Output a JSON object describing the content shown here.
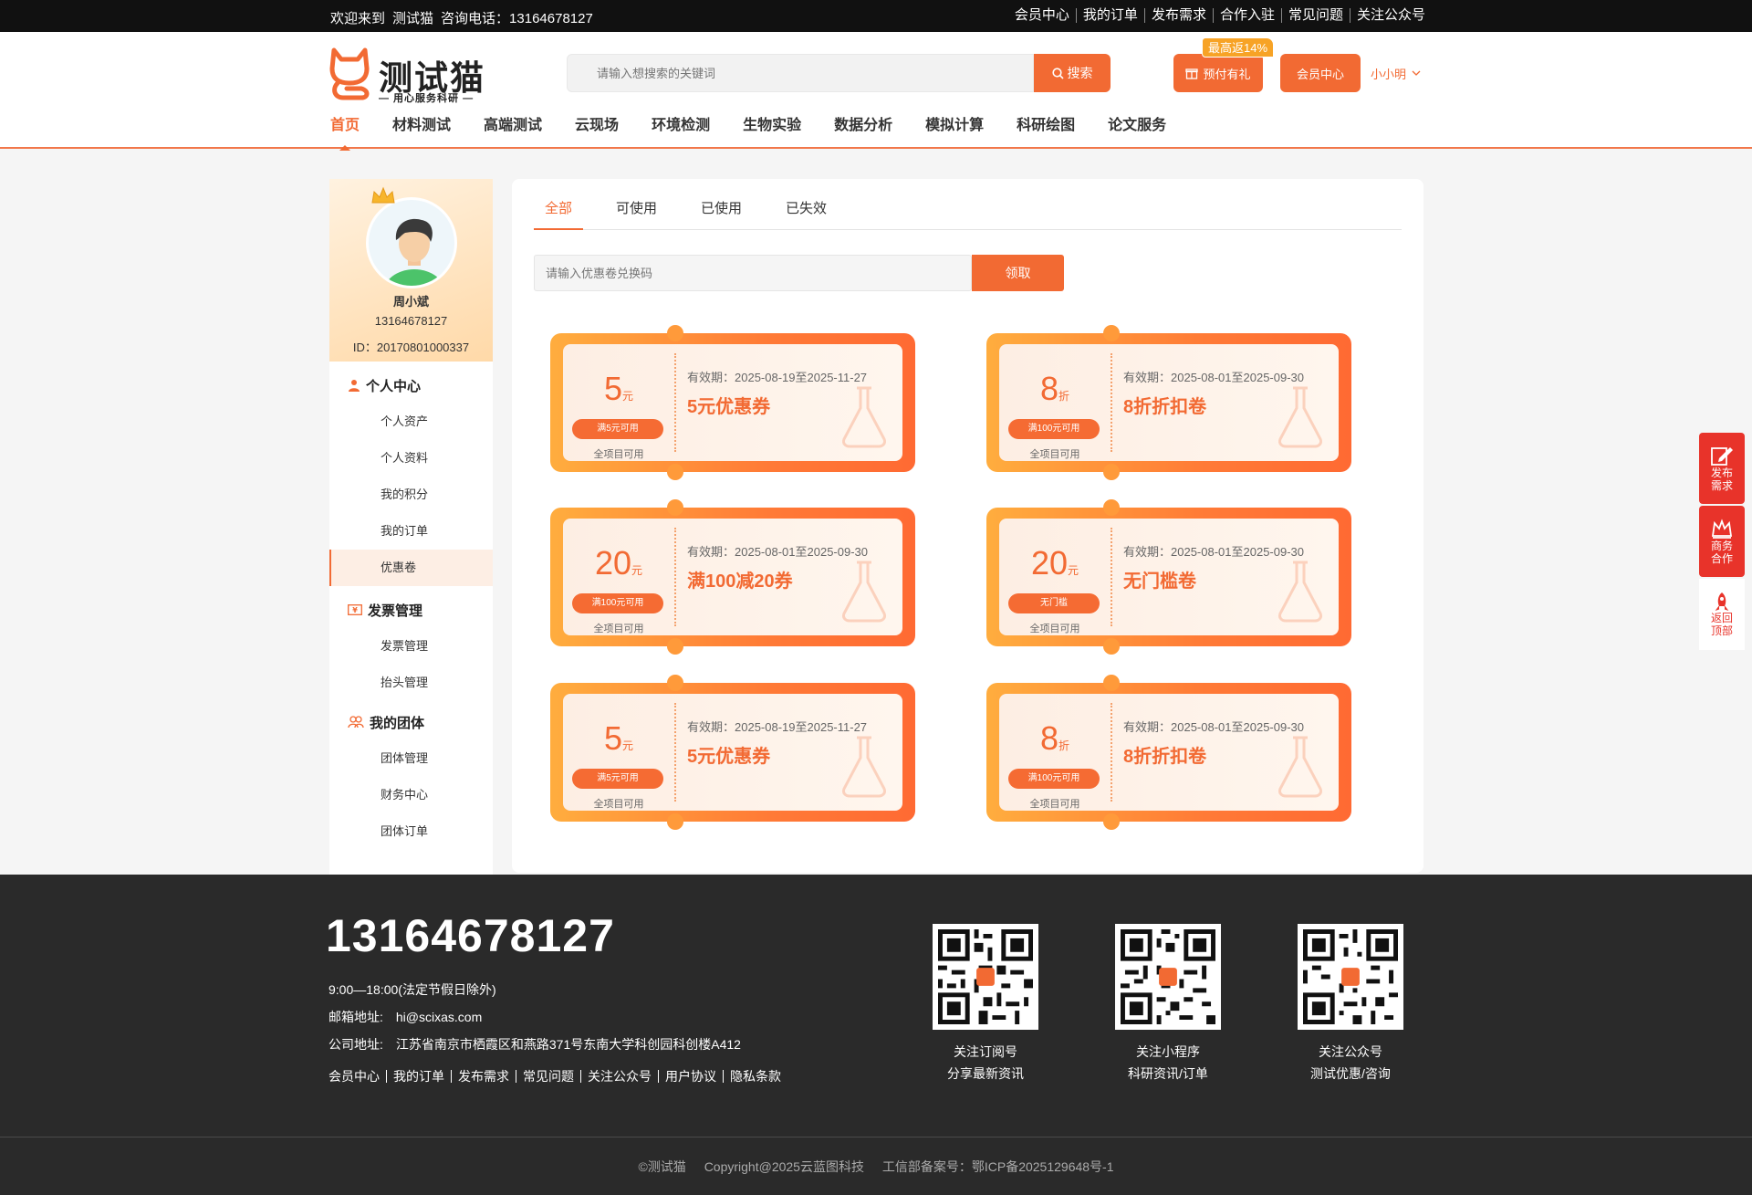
{
  "topbar": {
    "welcome": "欢迎来到",
    "site": "测试猫",
    "hotline_label": "咨询电话：",
    "hotline": "13164678127",
    "links": [
      "会员中心",
      "我的订单",
      "发布需求",
      "合作入驻",
      "常见问题",
      "关注公众号"
    ]
  },
  "header": {
    "brand": "测试猫",
    "slogan": "— 用心服务科研 —",
    "search_placeholder": "请输入想搜索的关键词",
    "search_label": "搜索",
    "promo_badge": "最高返14%",
    "prepay_label": "预付有礼",
    "member_label": "会员中心",
    "username": "小小明"
  },
  "nav": [
    "首页",
    "材料测试",
    "高端测试",
    "云现场",
    "环境检测",
    "生物实验",
    "数据分析",
    "模拟计算",
    "科研绘图",
    "论文服务"
  ],
  "profile": {
    "name": "周小斌",
    "phone": "13164678127",
    "id": "ID：20170801000337"
  },
  "menu": {
    "personal": {
      "title": "个人中心",
      "items": [
        "个人资产",
        "个人资料",
        "我的积分",
        "我的订单",
        "优惠卷"
      ]
    },
    "invoice": {
      "title": "发票管理",
      "items": [
        "发票管理",
        "抬头管理"
      ]
    },
    "team": {
      "title": "我的团体",
      "items": [
        "团体管理",
        "财务中心",
        "团体订单"
      ]
    }
  },
  "tabs": [
    "全部",
    "可使用",
    "已使用",
    "已失效"
  ],
  "redeem": {
    "placeholder": "请输入优惠卷兑换码",
    "button": "领取"
  },
  "coupons": [
    {
      "amount": "5",
      "unit": "元",
      "condition": "满5元可用",
      "scope": "全项目可用",
      "valid": "有效期：2025-08-19至2025-11-27",
      "title": "5元优惠券"
    },
    {
      "amount": "8",
      "unit": "折",
      "condition": "满100元可用",
      "scope": "全项目可用",
      "valid": "有效期：2025-08-01至2025-09-30",
      "title": "8折折扣卷"
    },
    {
      "amount": "20",
      "unit": "元",
      "condition": "满100元可用",
      "scope": "全项目可用",
      "valid": "有效期：2025-08-01至2025-09-30",
      "title": "满100减20券"
    },
    {
      "amount": "20",
      "unit": "元",
      "condition": "无门槛",
      "scope": "全项目可用",
      "valid": "有效期：2025-08-01至2025-09-30",
      "title": "无门槛卷"
    },
    {
      "amount": "5",
      "unit": "元",
      "condition": "满5元可用",
      "scope": "全项目可用",
      "valid": "有效期：2025-08-19至2025-11-27",
      "title": "5元优惠券"
    },
    {
      "amount": "8",
      "unit": "折",
      "condition": "满100元可用",
      "scope": "全项目可用",
      "valid": "有效期：2025-08-01至2025-09-30",
      "title": "8折折扣卷"
    }
  ],
  "float": {
    "publish": [
      "发布",
      "需求"
    ],
    "business": [
      "商务",
      "合作"
    ],
    "top": [
      "返回",
      "顶部"
    ]
  },
  "footer": {
    "phone": "13164678127",
    "hours": "9:00—18:00(法定节假日除外)",
    "email": "邮箱地址:　hi@scixas.com",
    "address": "公司地址:　江苏省南京市栖霞区和燕路371号东南大学科创园科创楼A412",
    "links": [
      "会员中心",
      "我的订单",
      "发布需求",
      "常见问题",
      "关注公众号",
      "用户协议",
      "隐私条款"
    ],
    "qrs": [
      {
        "line1": "关注订阅号",
        "line2": "分享最新资讯"
      },
      {
        "line1": "关注小程序",
        "line2": "科研资讯/订单"
      },
      {
        "line1": "关注公众号",
        "line2": "测试优惠/咨询"
      }
    ],
    "copyright": "©测试猫",
    "copyright2": "Copyright@2025云蓝图科技",
    "icp": "工信部备案号：鄂ICP备2025129648号-1"
  },
  "colors": {
    "accent": "#f26a33",
    "dark": "#111111",
    "footer": "#2a2a2a"
  }
}
